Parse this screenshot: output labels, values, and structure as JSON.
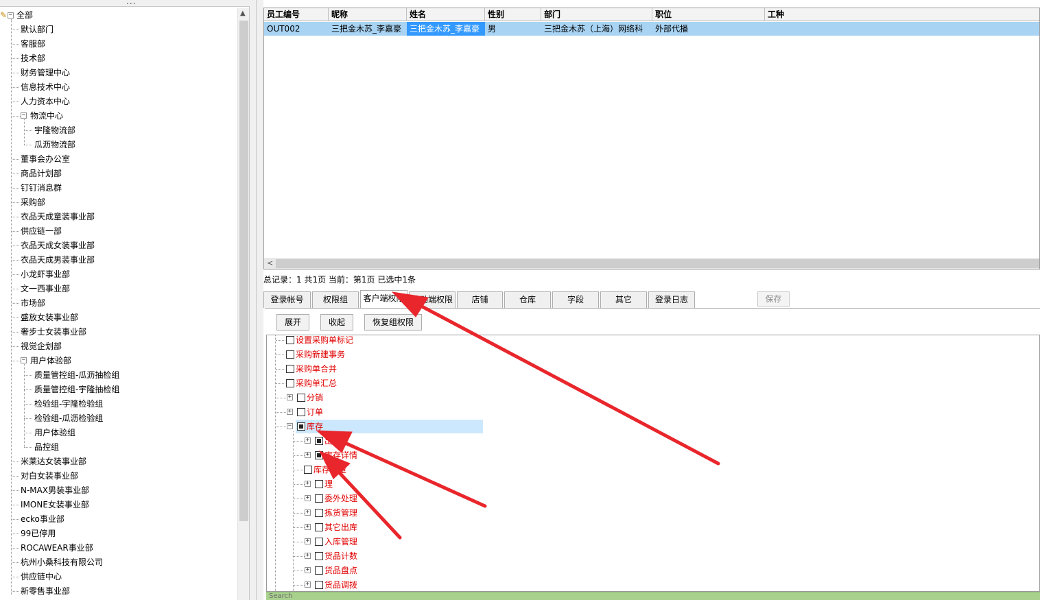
{
  "grip_label": "...",
  "left_tree": {
    "root_label": "全部",
    "nodes": [
      {
        "label": "默认部门"
      },
      {
        "label": "客服部"
      },
      {
        "label": "技术部"
      },
      {
        "label": "财务管理中心"
      },
      {
        "label": "信息技术中心"
      },
      {
        "label": "人力资本中心"
      },
      {
        "label": "物流中心",
        "expanded": true
      },
      {
        "label": "宇隆物流部",
        "child": true
      },
      {
        "label": "瓜沥物流部",
        "child": true
      },
      {
        "label": "董事会办公室"
      },
      {
        "label": "商品计划部"
      },
      {
        "label": "钉钉消息群"
      },
      {
        "label": "采购部"
      },
      {
        "label": "衣品天成童装事业部"
      },
      {
        "label": "供应链一部"
      },
      {
        "label": "衣品天成女装事业部"
      },
      {
        "label": "衣品天成男装事业部"
      },
      {
        "label": "小龙虾事业部"
      },
      {
        "label": "文一西事业部"
      },
      {
        "label": "市场部"
      },
      {
        "label": "盛放女装事业部"
      },
      {
        "label": "奢步士女装事业部"
      },
      {
        "label": "视觉企划部"
      },
      {
        "label": "用户体验部",
        "expanded": true
      },
      {
        "label": "质量管控组-瓜沥抽检组",
        "child": true
      },
      {
        "label": "质量管控组-宇隆抽检组",
        "child": true
      },
      {
        "label": "检验组-宇隆检验组",
        "child": true
      },
      {
        "label": "检验组-瓜沥检验组",
        "child": true
      },
      {
        "label": "用户体验组",
        "child": true
      },
      {
        "label": "品控组",
        "child": true
      },
      {
        "label": "米莱达女装事业部"
      },
      {
        "label": "对白女装事业部"
      },
      {
        "label": "N-MAX男装事业部"
      },
      {
        "label": "IMONE女装事业部"
      },
      {
        "label": "ecko事业部"
      },
      {
        "label": "99已停用"
      },
      {
        "label": "ROCAWEAR事业部"
      },
      {
        "label": "杭州小桑科技有限公司"
      },
      {
        "label": "供应链中心"
      },
      {
        "label": "新零售事业部"
      }
    ]
  },
  "grid": {
    "columns": [
      "员工编号",
      "昵称",
      "姓名",
      "性别",
      "部门",
      "职位",
      "工种"
    ],
    "rows": [
      [
        "OUT002",
        "三把金木苏_李嘉豪",
        "三把金木苏_李嘉豪",
        "男",
        "三把金木苏（上海）网络科",
        "外部代播",
        ""
      ]
    ]
  },
  "status": "总记录：1  共1页  当前：第1页  已选中1条",
  "tabs": [
    "登录帐号",
    "权限组",
    "客户端权限",
    "移动端权限",
    "店铺",
    "仓库",
    "字段",
    "其它",
    "登录日志"
  ],
  "active_tab": "客户端权限",
  "save_label": "保存",
  "actions": {
    "expand": "展开",
    "collapse": "收起",
    "restore": "恢复组权限"
  },
  "perm_tree": [
    {
      "label": "设置采购单标记",
      "level": 1,
      "checked": false
    },
    {
      "label": "采购新建事务",
      "level": 1,
      "checked": false
    },
    {
      "label": "采购单合并",
      "level": 1,
      "checked": false
    },
    {
      "label": "采购单汇总",
      "level": 1,
      "checked": false
    },
    {
      "label": "分销",
      "level": 1,
      "checked": false,
      "expander": "plus"
    },
    {
      "label": "订单",
      "level": 1,
      "checked": false,
      "expander": "plus"
    },
    {
      "label": "库存",
      "level": 1,
      "checked": "partial",
      "expander": "minus",
      "selected": true
    },
    {
      "label": "出库",
      "level": 2,
      "checked": "partial",
      "expander": "plus"
    },
    {
      "label": "库存详情",
      "level": 2,
      "checked": "partial",
      "expander": "plus"
    },
    {
      "label": "库存容量",
      "level": 2,
      "checked": false
    },
    {
      "label": "理",
      "level": 2,
      "checked": false,
      "expander": "plus"
    },
    {
      "label": "委外处理",
      "level": 2,
      "checked": false,
      "expander": "plus"
    },
    {
      "label": "拣货管理",
      "level": 2,
      "checked": false,
      "expander": "plus"
    },
    {
      "label": "其它出库",
      "level": 2,
      "checked": false,
      "expander": "plus"
    },
    {
      "label": "入库管理",
      "level": 2,
      "checked": false,
      "expander": "plus"
    },
    {
      "label": "货品计数",
      "level": 2,
      "checked": false,
      "expander": "plus"
    },
    {
      "label": "货品盘点",
      "level": 2,
      "checked": false,
      "expander": "plus"
    },
    {
      "label": "货品调拨",
      "level": 2,
      "checked": false,
      "expander": "plus"
    }
  ],
  "search_placeholder": "Search",
  "colors": {
    "selected_row": "#a8d3f3",
    "selected_cell": "#3399ff",
    "perm_text": "#e00000",
    "arrow": "#e8262b",
    "search_bar": "#a9d18e"
  }
}
